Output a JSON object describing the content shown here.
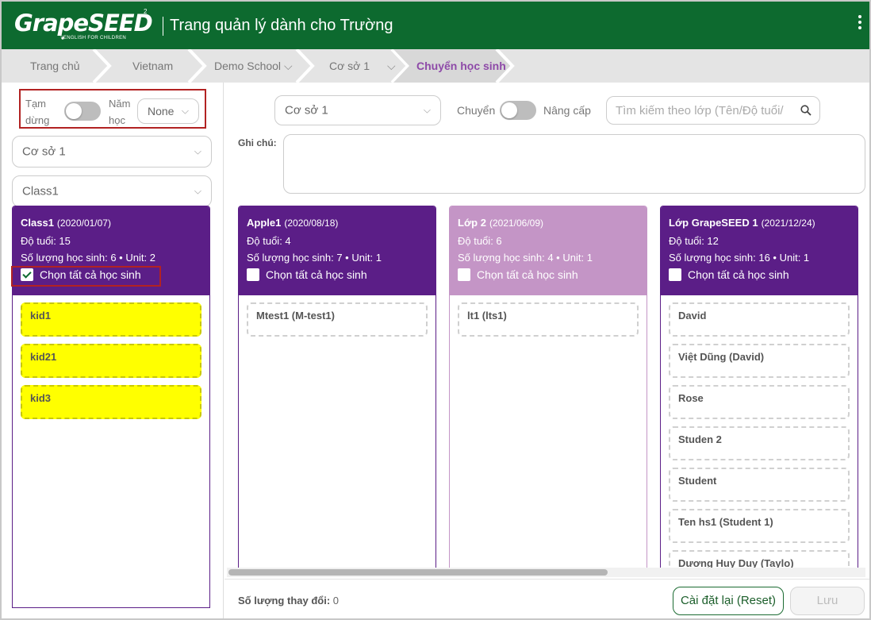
{
  "header": {
    "logo_text": "GrapeSEED",
    "logo_tagline": "ENGLISH FOR CHILDREN",
    "title": "Trang quản lý dành cho Trường",
    "colors": {
      "header_bg": "#0d6a2f",
      "class_purple": "#5b1e87",
      "class_light": "#c495c6",
      "highlight_card": "#ffff00"
    }
  },
  "breadcrumb": {
    "items": [
      "Trang chủ",
      "Vietnam",
      "Demo School",
      "Cơ sở 1",
      "Chuyển học sinh"
    ],
    "active_index": 4
  },
  "left_panel": {
    "pause_label_1": "Tạm",
    "pause_label_2": "dừng",
    "year_label_1": "Năm",
    "year_label_2": "học",
    "year_value": "None",
    "campus_value": "Cơ sở 1",
    "class_value": "Class1",
    "source_class": {
      "name": "Class1",
      "date": "(2020/01/07)",
      "age": "Độ tuổi: 15",
      "count": "Số lượng học sinh: 6 • Unit: 2",
      "select_all": "Chọn tất cả học sinh",
      "select_all_checked": true,
      "students": [
        "kid1",
        "kid21",
        "kid3"
      ]
    }
  },
  "toolbar": {
    "campus_value": "Cơ sở 1",
    "transfer_label": "Chuyển",
    "upgrade_label": "Nâng cấp",
    "search_placeholder": "Tìm kiếm theo lớp (Tên/Độ tuổi/",
    "note_label": "Ghi chú:"
  },
  "target_classes": [
    {
      "name": "Apple1",
      "date": "(2020/08/18)",
      "age": "Độ tuổi: 4",
      "count": "Số lượng học sinh: 7 • Unit: 1",
      "select_all": "Chọn tất cả học sinh",
      "students": [
        "Mtest1 (M-test1)"
      ]
    },
    {
      "name": "Lớp 2",
      "date": "(2021/06/09)",
      "age": "Độ tuổi: 6",
      "count": "Số lượng học sinh: 4 • Unit: 1",
      "select_all": "Chọn tất cả học sinh",
      "students": [
        "lt1 (lts1)"
      ]
    },
    {
      "name": "Lớp GrapeSEED 1",
      "date": "(2021/12/24)",
      "age": "Độ tuổi: 12",
      "count": "Số lượng học sinh: 16 • Unit: 1",
      "select_all": "Chọn tất cả học sinh",
      "students": [
        "David",
        "Việt Dũng (David)",
        "Rose",
        "Studen 2",
        "Student",
        "Ten hs1 (Student 1)",
        "Dương Huy Duy (Taylo)"
      ]
    }
  ],
  "footer": {
    "change_count_label": "Số lượng thay đổi:",
    "change_count_value": "0",
    "reset_label": "Cài đặt lại (Reset)",
    "save_label": "Lưu"
  }
}
